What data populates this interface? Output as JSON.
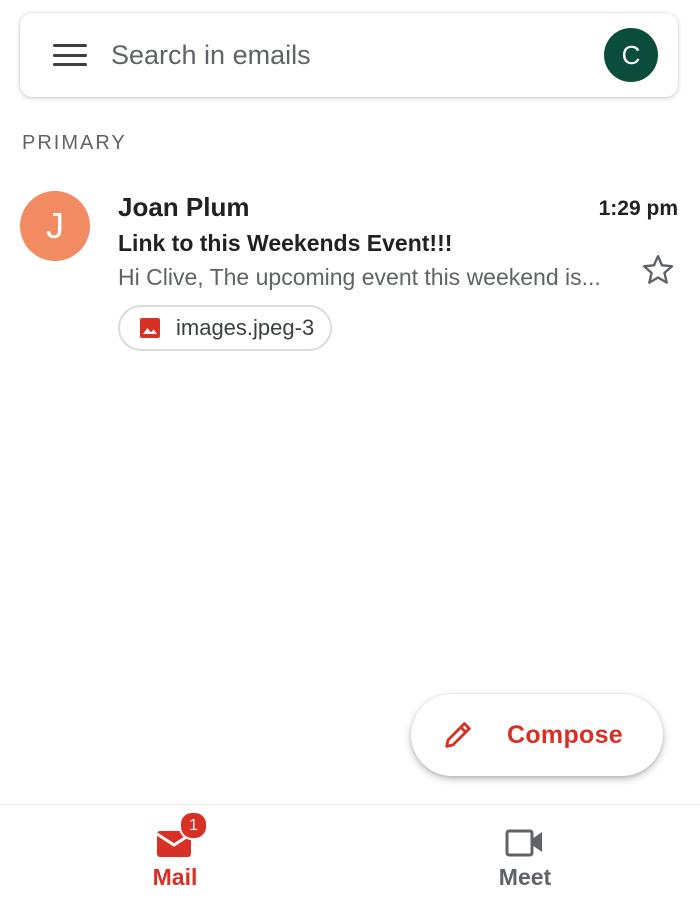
{
  "search": {
    "placeholder": "Search in emails",
    "account_initial": "C"
  },
  "section": {
    "label": "PRIMARY"
  },
  "emails": [
    {
      "sender_initial": "J",
      "sender": "Joan Plum",
      "time": "1:29 pm",
      "subject": "Link to this Weekends Event!!!",
      "snippet": "Hi Clive, The upcoming event this weekend is...",
      "attachment": "images.jpeg-3",
      "starred": false
    }
  ],
  "compose": {
    "label": "Compose"
  },
  "nav": {
    "mail_label": "Mail",
    "mail_badge": "1",
    "meet_label": "Meet"
  },
  "colors": {
    "accent_red": "#d93025",
    "account_avatar": "#0b4d3c",
    "sender_avatar": "#f28b62",
    "meet_gray": "#5f6368"
  }
}
